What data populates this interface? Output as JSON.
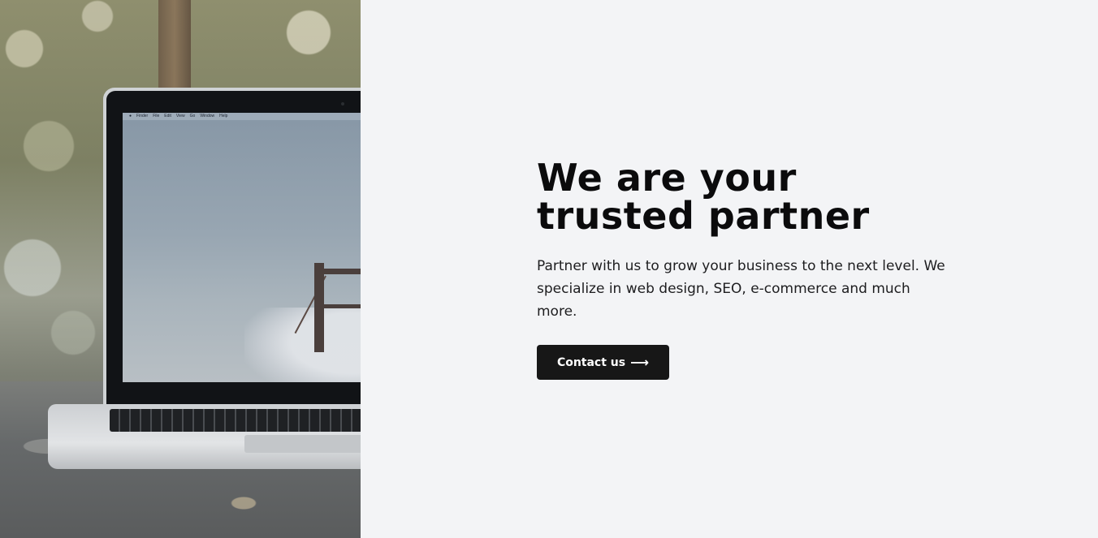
{
  "photo": {
    "alt": "Laptop on a wooden table with a bridge wallpaper",
    "menubar": [
      "Finder",
      "File",
      "Edit",
      "View",
      "Go",
      "Window",
      "Help"
    ]
  },
  "hero": {
    "title": "We are your trusted partner",
    "text": "Partner with us to grow your business to the next level. We specialize in web design, SEO, e-commerce and much more.",
    "cta_label": "Contact us",
    "cta_icon": "arrow-right-icon",
    "cta_icon_glyph": "⟶"
  },
  "colors": {
    "background": "#f3f4f6",
    "heading": "#0b0b0c",
    "button": "#171717",
    "button_text": "#ffffff"
  }
}
